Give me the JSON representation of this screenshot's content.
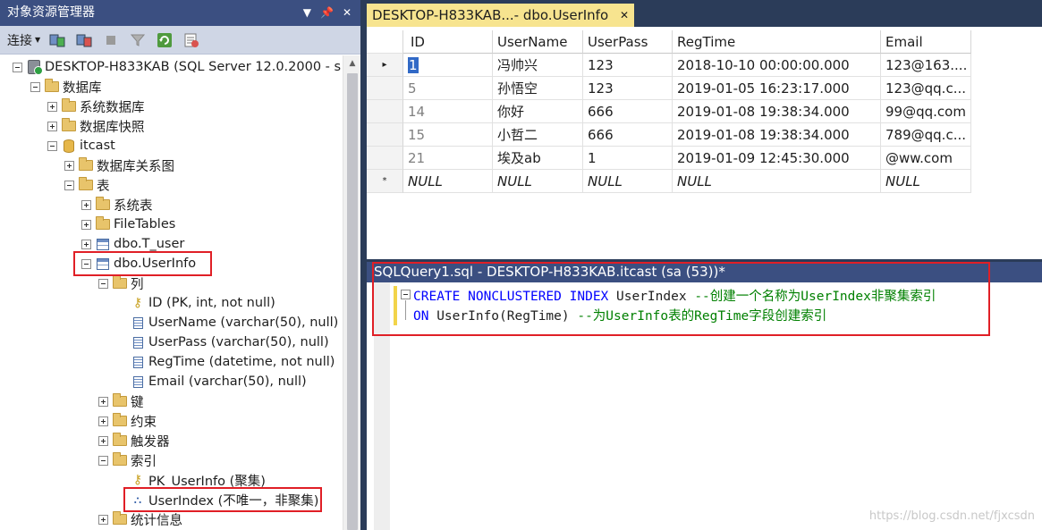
{
  "object_explorer": {
    "title": "对象资源管理器",
    "title_buttons": [
      "▼",
      "📌",
      "✕"
    ],
    "toolbar": {
      "connect_label": "连接"
    },
    "tree": [
      {
        "label": "DESKTOP-H833KAB (SQL Server 12.0.2000 - s",
        "icon": "server-icon",
        "expander": "minus"
      },
      {
        "label": "数据库",
        "icon": "folder-icon",
        "expander": "minus"
      },
      {
        "label": "系统数据库",
        "icon": "folder-icon",
        "expander": "plus"
      },
      {
        "label": "数据库快照",
        "icon": "folder-icon",
        "expander": "plus"
      },
      {
        "label": "itcast",
        "icon": "database-icon",
        "expander": "minus"
      },
      {
        "label": "数据库关系图",
        "icon": "folder-icon",
        "expander": "plus"
      },
      {
        "label": "表",
        "icon": "folder-icon",
        "expander": "minus"
      },
      {
        "label": "系统表",
        "icon": "folder-icon",
        "expander": "plus"
      },
      {
        "label": "FileTables",
        "icon": "folder-icon",
        "expander": "plus"
      },
      {
        "label": "dbo.T_user",
        "icon": "table-icon",
        "expander": "plus"
      },
      {
        "label": "dbo.UserInfo",
        "icon": "table-icon",
        "expander": "minus"
      },
      {
        "label": "列",
        "icon": "folder-icon",
        "expander": "minus"
      },
      {
        "label": "ID (PK, int, not null)",
        "icon": "primary-key-icon",
        "expander": "none"
      },
      {
        "label": "UserName (varchar(50), null)",
        "icon": "column-icon",
        "expander": "none"
      },
      {
        "label": "UserPass (varchar(50), null)",
        "icon": "column-icon",
        "expander": "none"
      },
      {
        "label": "RegTime (datetime, not null)",
        "icon": "column-icon",
        "expander": "none"
      },
      {
        "label": "Email (varchar(50), null)",
        "icon": "column-icon",
        "expander": "none"
      },
      {
        "label": "键",
        "icon": "folder-icon",
        "expander": "plus"
      },
      {
        "label": "约束",
        "icon": "folder-icon",
        "expander": "plus"
      },
      {
        "label": "触发器",
        "icon": "folder-icon",
        "expander": "plus"
      },
      {
        "label": "索引",
        "icon": "folder-icon",
        "expander": "minus"
      },
      {
        "label": "PK_UserInfo (聚集)",
        "icon": "primary-key-icon",
        "expander": "none"
      },
      {
        "label": "UserIndex (不唯一，非聚集)",
        "icon": "index-icon",
        "expander": "none"
      },
      {
        "label": "统计信息",
        "icon": "folder-icon",
        "expander": "plus"
      }
    ]
  },
  "results": {
    "tab_label": "DESKTOP-H833KAB...- dbo.UserInfo",
    "columns": [
      "ID",
      "UserName",
      "UserPass",
      "RegTime",
      "Email"
    ],
    "rows": [
      [
        "1",
        "冯帅兴",
        "123",
        "2018-10-10 00:00:00.000",
        "123@163...."
      ],
      [
        "5",
        "孙悟空",
        "123",
        "2019-01-05 16:23:17.000",
        "123@qq.c..."
      ],
      [
        "14",
        "你好",
        "666",
        "2019-01-08 19:38:34.000",
        "99@qq.com"
      ],
      [
        "15",
        "小哲二",
        "666",
        "2019-01-08 19:38:34.000",
        "789@qq.c..."
      ],
      [
        "21",
        "埃及ab",
        "1",
        "2019-01-09 12:45:30.000",
        "@ww.com"
      ],
      [
        "NULL",
        "NULL",
        "NULL",
        "NULL",
        "NULL"
      ]
    ],
    "row_markers": [
      "▸",
      "",
      "",
      "",
      "",
      "*"
    ]
  },
  "query": {
    "title": "SQLQuery1.sql - DESKTOP-H833KAB.itcast (sa (53))*",
    "line1": {
      "kw1": "CREATE",
      "kw2": "NONCLUSTERED",
      "kw3": "INDEX",
      "ident": "UserIndex",
      "comment": "--创建一个名称为UserIndex非聚集索引"
    },
    "line2": {
      "kw1": "ON",
      "ident": "UserInfo(RegTime)",
      "comment": "--为UserInfo表的RegTime字段创建索引"
    }
  },
  "watermark": "https://blog.csdn.net/fjxcsdn",
  "colors": {
    "accent_title_bar": "#3b4f81",
    "active_tab": "#f7e48f",
    "highlight_box": "#e01f26",
    "selected_cell": "#3169c6"
  }
}
